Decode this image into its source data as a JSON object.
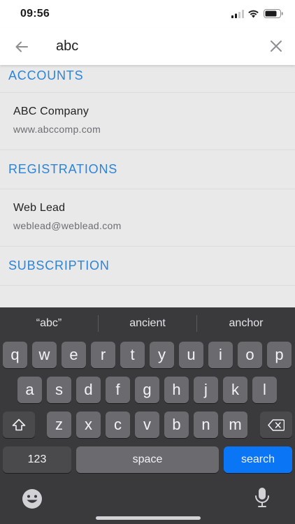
{
  "status_bar": {
    "time": "09:56"
  },
  "search": {
    "query": "abc"
  },
  "results": {
    "accounts": {
      "header": "ACCOUNTS",
      "items": [
        {
          "title": "ABC Company",
          "subtitle": "www.abccomp.com"
        }
      ]
    },
    "registrations": {
      "header": "REGISTRATIONS",
      "items": [
        {
          "title": "Web Lead",
          "subtitle": "weblead@weblead.com"
        }
      ]
    },
    "subscription": {
      "header": "SUBSCRIPTION"
    }
  },
  "keyboard": {
    "suggestions": [
      "“abc”",
      "ancient",
      "anchor"
    ],
    "row1": [
      "q",
      "w",
      "e",
      "r",
      "t",
      "y",
      "u",
      "i",
      "o",
      "p"
    ],
    "row2": [
      "a",
      "s",
      "d",
      "f",
      "g",
      "h",
      "j",
      "k",
      "l"
    ],
    "row3": [
      "z",
      "x",
      "c",
      "v",
      "b",
      "n",
      "m"
    ],
    "numbers_key": "123",
    "space_key": "space",
    "search_key": "search"
  },
  "colors": {
    "accent": "#2b84d8",
    "search_key": "#0b76f5",
    "keyboard_bg": "#3a3a3c"
  }
}
